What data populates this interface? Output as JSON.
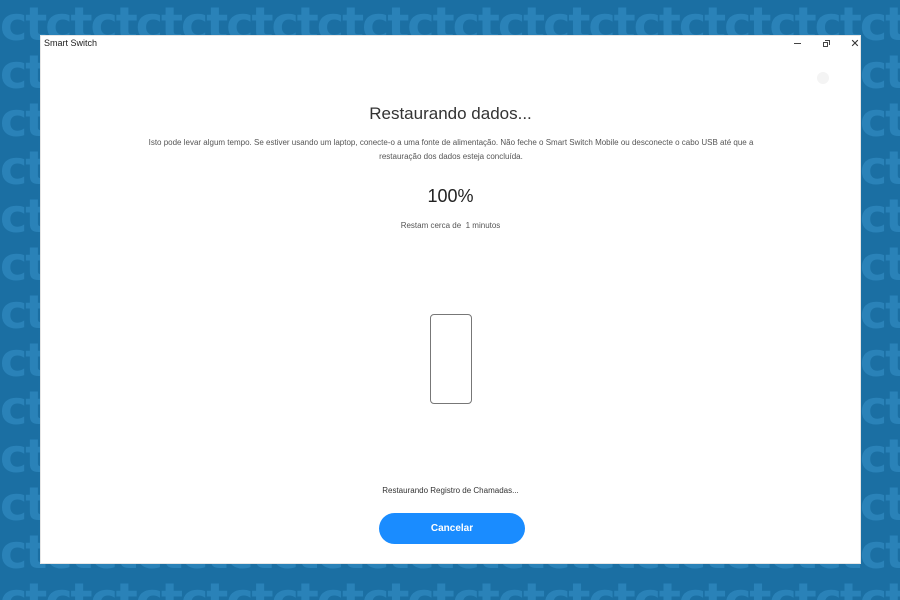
{
  "window": {
    "title": "Smart Switch",
    "controls": {
      "minimize_icon": "minimize-icon",
      "maximize_icon": "restore-icon",
      "close_icon": "close-icon",
      "close_glyph": "✕"
    }
  },
  "main": {
    "heading": "Restaurando dados...",
    "description": "Isto pode levar algum tempo. Se estiver usando um laptop, conecte-o a uma fonte de alimentação. Não feche o Smart Switch Mobile ou desconecte o cabo USB até que a restauração dos dados esteja concluída.",
    "progress_text": "100%",
    "progress_value": 1.0,
    "remaining_prefix": "Restam cerca de",
    "remaining_value": "1",
    "remaining_unit": "minutos",
    "device_icon": "smartphone-outline-icon",
    "status": "Restaurando Registro de Chamadas...",
    "cancel_label": "Cancelar"
  },
  "colors": {
    "background": "#1b6fa3",
    "window": "#ffffff",
    "accent_button": "#1a8cff"
  }
}
